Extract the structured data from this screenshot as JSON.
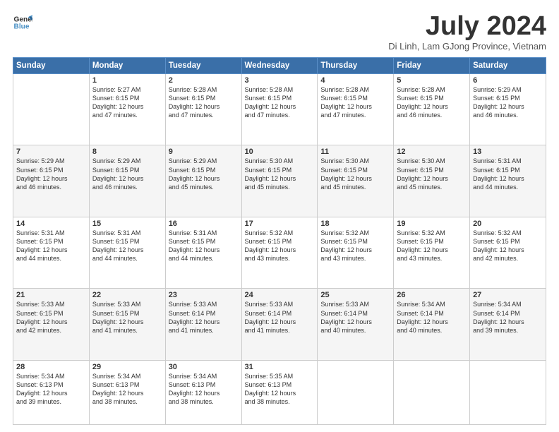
{
  "header": {
    "logo_line1": "General",
    "logo_line2": "Blue",
    "month": "July 2024",
    "location": "Di Linh, Lam GJong Province, Vietnam"
  },
  "weekdays": [
    "Sunday",
    "Monday",
    "Tuesday",
    "Wednesday",
    "Thursday",
    "Friday",
    "Saturday"
  ],
  "weeks": [
    [
      {
        "day": "",
        "info": ""
      },
      {
        "day": "1",
        "info": "Sunrise: 5:27 AM\nSunset: 6:15 PM\nDaylight: 12 hours\nand 47 minutes."
      },
      {
        "day": "2",
        "info": "Sunrise: 5:28 AM\nSunset: 6:15 PM\nDaylight: 12 hours\nand 47 minutes."
      },
      {
        "day": "3",
        "info": "Sunrise: 5:28 AM\nSunset: 6:15 PM\nDaylight: 12 hours\nand 47 minutes."
      },
      {
        "day": "4",
        "info": "Sunrise: 5:28 AM\nSunset: 6:15 PM\nDaylight: 12 hours\nand 47 minutes."
      },
      {
        "day": "5",
        "info": "Sunrise: 5:28 AM\nSunset: 6:15 PM\nDaylight: 12 hours\nand 46 minutes."
      },
      {
        "day": "6",
        "info": "Sunrise: 5:29 AM\nSunset: 6:15 PM\nDaylight: 12 hours\nand 46 minutes."
      }
    ],
    [
      {
        "day": "7",
        "info": "Sunrise: 5:29 AM\nSunset: 6:15 PM\nDaylight: 12 hours\nand 46 minutes."
      },
      {
        "day": "8",
        "info": "Sunrise: 5:29 AM\nSunset: 6:15 PM\nDaylight: 12 hours\nand 46 minutes."
      },
      {
        "day": "9",
        "info": "Sunrise: 5:29 AM\nSunset: 6:15 PM\nDaylight: 12 hours\nand 45 minutes."
      },
      {
        "day": "10",
        "info": "Sunrise: 5:30 AM\nSunset: 6:15 PM\nDaylight: 12 hours\nand 45 minutes."
      },
      {
        "day": "11",
        "info": "Sunrise: 5:30 AM\nSunset: 6:15 PM\nDaylight: 12 hours\nand 45 minutes."
      },
      {
        "day": "12",
        "info": "Sunrise: 5:30 AM\nSunset: 6:15 PM\nDaylight: 12 hours\nand 45 minutes."
      },
      {
        "day": "13",
        "info": "Sunrise: 5:31 AM\nSunset: 6:15 PM\nDaylight: 12 hours\nand 44 minutes."
      }
    ],
    [
      {
        "day": "14",
        "info": "Sunrise: 5:31 AM\nSunset: 6:15 PM\nDaylight: 12 hours\nand 44 minutes."
      },
      {
        "day": "15",
        "info": "Sunrise: 5:31 AM\nSunset: 6:15 PM\nDaylight: 12 hours\nand 44 minutes."
      },
      {
        "day": "16",
        "info": "Sunrise: 5:31 AM\nSunset: 6:15 PM\nDaylight: 12 hours\nand 44 minutes."
      },
      {
        "day": "17",
        "info": "Sunrise: 5:32 AM\nSunset: 6:15 PM\nDaylight: 12 hours\nand 43 minutes."
      },
      {
        "day": "18",
        "info": "Sunrise: 5:32 AM\nSunset: 6:15 PM\nDaylight: 12 hours\nand 43 minutes."
      },
      {
        "day": "19",
        "info": "Sunrise: 5:32 AM\nSunset: 6:15 PM\nDaylight: 12 hours\nand 43 minutes."
      },
      {
        "day": "20",
        "info": "Sunrise: 5:32 AM\nSunset: 6:15 PM\nDaylight: 12 hours\nand 42 minutes."
      }
    ],
    [
      {
        "day": "21",
        "info": "Sunrise: 5:33 AM\nSunset: 6:15 PM\nDaylight: 12 hours\nand 42 minutes."
      },
      {
        "day": "22",
        "info": "Sunrise: 5:33 AM\nSunset: 6:15 PM\nDaylight: 12 hours\nand 41 minutes."
      },
      {
        "day": "23",
        "info": "Sunrise: 5:33 AM\nSunset: 6:14 PM\nDaylight: 12 hours\nand 41 minutes."
      },
      {
        "day": "24",
        "info": "Sunrise: 5:33 AM\nSunset: 6:14 PM\nDaylight: 12 hours\nand 41 minutes."
      },
      {
        "day": "25",
        "info": "Sunrise: 5:33 AM\nSunset: 6:14 PM\nDaylight: 12 hours\nand 40 minutes."
      },
      {
        "day": "26",
        "info": "Sunrise: 5:34 AM\nSunset: 6:14 PM\nDaylight: 12 hours\nand 40 minutes."
      },
      {
        "day": "27",
        "info": "Sunrise: 5:34 AM\nSunset: 6:14 PM\nDaylight: 12 hours\nand 39 minutes."
      }
    ],
    [
      {
        "day": "28",
        "info": "Sunrise: 5:34 AM\nSunset: 6:13 PM\nDaylight: 12 hours\nand 39 minutes."
      },
      {
        "day": "29",
        "info": "Sunrise: 5:34 AM\nSunset: 6:13 PM\nDaylight: 12 hours\nand 38 minutes."
      },
      {
        "day": "30",
        "info": "Sunrise: 5:34 AM\nSunset: 6:13 PM\nDaylight: 12 hours\nand 38 minutes."
      },
      {
        "day": "31",
        "info": "Sunrise: 5:35 AM\nSunset: 6:13 PM\nDaylight: 12 hours\nand 38 minutes."
      },
      {
        "day": "",
        "info": ""
      },
      {
        "day": "",
        "info": ""
      },
      {
        "day": "",
        "info": ""
      }
    ]
  ]
}
